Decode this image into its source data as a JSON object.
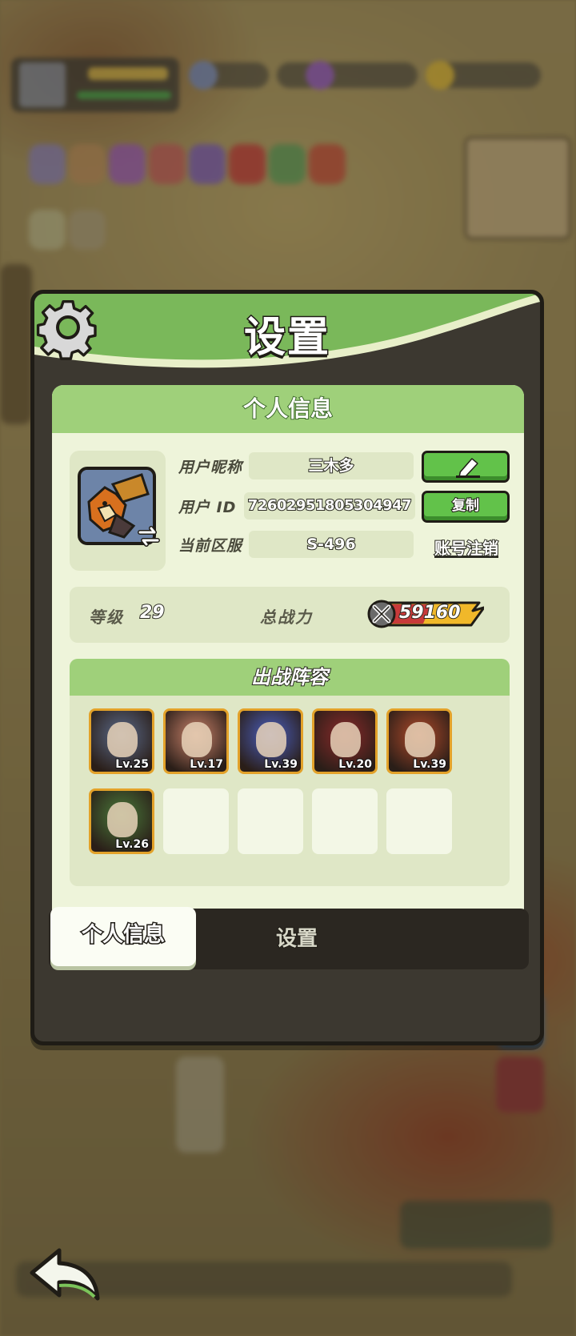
{
  "dialog": {
    "title": "设置",
    "panel_title": "个人信息",
    "profile": {
      "nickname_label": "用户昵称",
      "nickname": "三木多",
      "id_label": "用户 ID",
      "user_id": "7260295180530494​7",
      "server_label": "当前区服",
      "server": "S-496",
      "copy_button": "复制",
      "logout_link": "账号注销"
    },
    "stats": {
      "level_label": "等级",
      "level": "29",
      "power_label": "总战力",
      "power": "59160"
    },
    "lineup": {
      "title": "出战阵容",
      "heroes": [
        {
          "level": "Lv.25",
          "color": "#5a6a8a"
        },
        {
          "level": "Lv.17",
          "color": "#c9826a"
        },
        {
          "level": "Lv.39",
          "color": "#4a5fc0"
        },
        {
          "level": "Lv.20",
          "color": "#8a2a2a"
        },
        {
          "level": "Lv.39",
          "color": "#b04a2a"
        },
        {
          "level": "Lv.26",
          "color": "#4a7a3a"
        }
      ]
    },
    "tabs": [
      "个人信息",
      "设置"
    ]
  },
  "colors": {
    "header_green": "#7ab85a",
    "panel_bg": "#eef4da",
    "button_green": "#62c24a",
    "slot_border": "#e3a22a"
  }
}
